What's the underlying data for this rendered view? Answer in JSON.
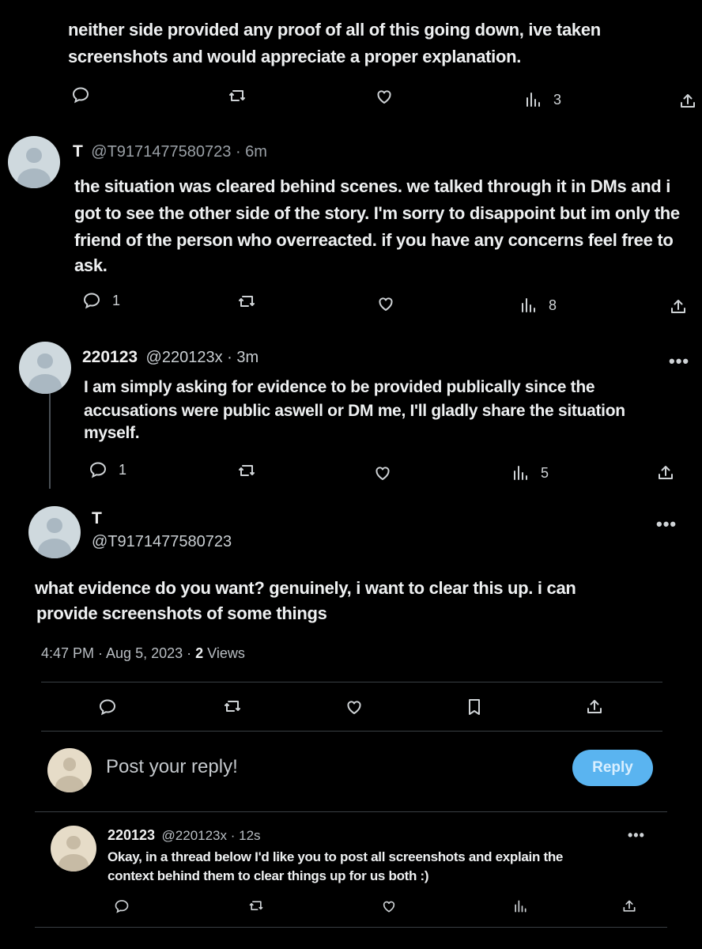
{
  "tweet0": {
    "text_line0": "neither side provided any proof of all of this going down, ive taken",
    "text_line1": "screenshots and would appreciate a proper explanation.",
    "views": "3",
    "icons": [
      "reply-icon",
      "retweet-icon",
      "like-icon",
      "views-icon",
      "share-icon"
    ]
  },
  "tweet1": {
    "name": "T",
    "handle": "@T9171477580723 · 6m",
    "line0": "the situation was cleared behind scenes. we talked through it in DMs and i",
    "line1": "got to see the other side of the story. I'm sorry to disappoint but im only the",
    "line2": "friend of the person who overreacted. if you have any concerns feel free to",
    "line3": "ask.",
    "replies": "1",
    "views": "8"
  },
  "tweet2": {
    "name": "220123",
    "handle": "@220123x · 3m",
    "line0": "I am simply asking for evidence to be provided publically since the",
    "line1": "accusations were public aswell or DM me, I'll gladly share the situation",
    "line2": "myself.",
    "replies": "1",
    "views": "5"
  },
  "main": {
    "name": "T",
    "handle": "@T9171477580723",
    "line0": "what evidence do you want? genuinely, i want to clear this up. i can",
    "line1": "provide screenshots of some things",
    "timestamp": "4:47 PM · Aug 5, 2023 · ",
    "views_count": "2",
    "views_label": " Views"
  },
  "compose": {
    "placeholder": "Post your reply!",
    "button": "Reply"
  },
  "tweet3": {
    "name": "220123",
    "handle": "@220123x · 12s",
    "line0": "Okay, in a thread below I'd like you to post all screenshots and explain the",
    "line1": "context behind them to clear things up for us both :)"
  },
  "more_glyph": "•••",
  "colors": {
    "background": "#000000",
    "accent": "#5ab4f0",
    "text": "#e7e9ea",
    "muted": "#9aa0a6"
  }
}
